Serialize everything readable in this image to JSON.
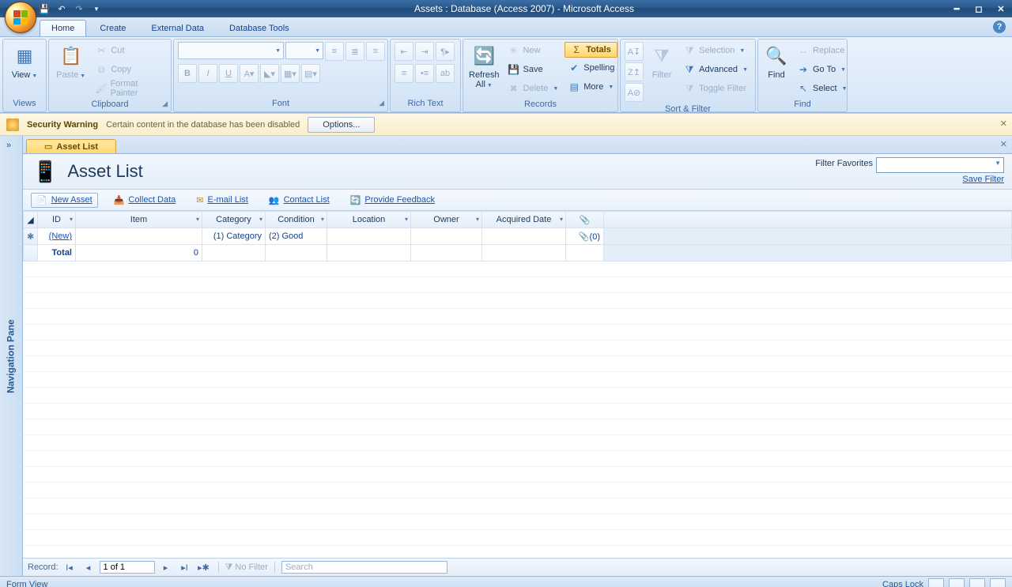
{
  "title": "Assets : Database (Access 2007) - Microsoft Access",
  "tabs": [
    "Home",
    "Create",
    "External Data",
    "Database Tools"
  ],
  "ribbon": {
    "views": {
      "label": "Views",
      "btn": "View"
    },
    "clipboard": {
      "label": "Clipboard",
      "paste": "Paste",
      "cut": "Cut",
      "copy": "Copy",
      "fmt": "Format Painter"
    },
    "font": {
      "label": "Font"
    },
    "richtext": {
      "label": "Rich Text"
    },
    "records": {
      "label": "Records",
      "refresh": "Refresh All",
      "new": "New",
      "save": "Save",
      "delete": "Delete",
      "totals": "Totals",
      "spelling": "Spelling",
      "more": "More"
    },
    "sortfilter": {
      "label": "Sort & Filter",
      "filter": "Filter",
      "selection": "Selection",
      "advanced": "Advanced",
      "toggle": "Toggle Filter"
    },
    "find": {
      "label": "Find",
      "find": "Find",
      "replace": "Replace",
      "goto": "Go To",
      "select": "Select"
    }
  },
  "security": {
    "title": "Security Warning",
    "msg": "Certain content in the database has been disabled",
    "options": "Options..."
  },
  "nav": {
    "label": "Navigation Pane"
  },
  "doc": {
    "tab": "Asset List",
    "heading": "Asset List",
    "filterfav": "Filter Favorites",
    "savefilter": "Save Filter",
    "toolbar": {
      "new": "New Asset",
      "collect": "Collect Data",
      "email": "E-mail List",
      "contact": "Contact List",
      "feedback": "Provide Feedback"
    },
    "columns": [
      "ID",
      "Item",
      "Category",
      "Condition",
      "Location",
      "Owner",
      "Acquired Date"
    ],
    "row_new": {
      "id": "(New)",
      "category": "(1) Category",
      "condition": "(2) Good",
      "att": "(0)"
    },
    "totals": {
      "label": "Total",
      "val": "0"
    }
  },
  "recnav": {
    "label": "Record:",
    "value": "1 of 1",
    "nofilter": "No Filter",
    "search": "Search"
  },
  "status": {
    "left": "Form View",
    "caps": "Caps Lock"
  }
}
